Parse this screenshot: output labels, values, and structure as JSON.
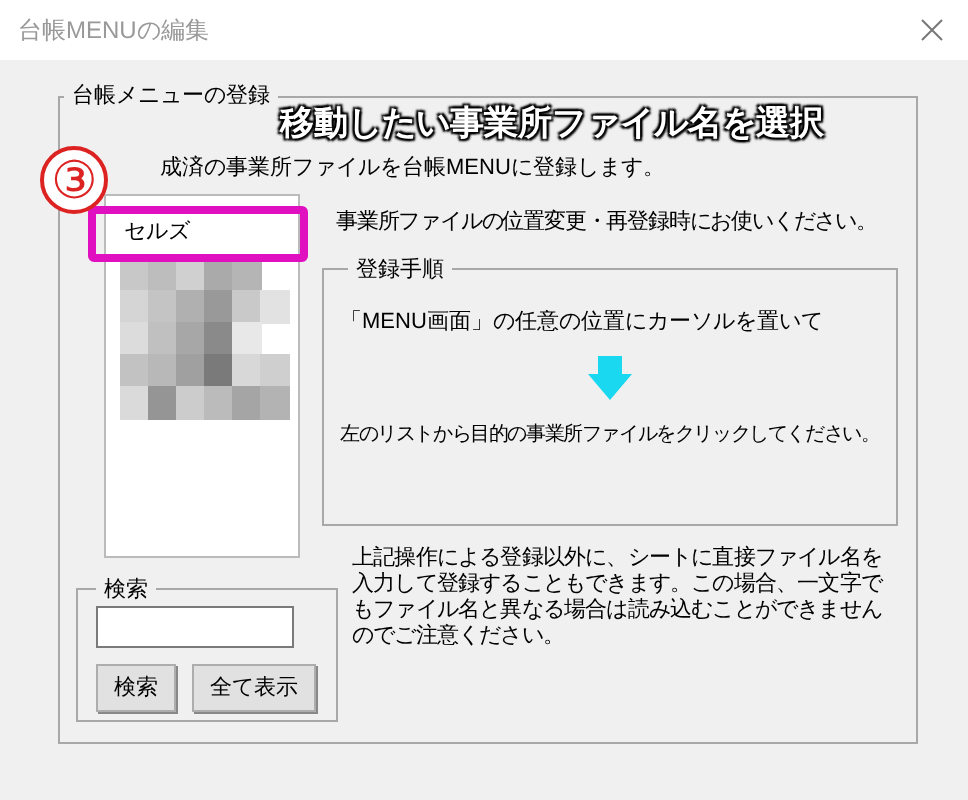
{
  "window": {
    "title": "台帳MENUの編集"
  },
  "group": {
    "title": "台帳メニューの登録",
    "intro": "成済の事業所ファイルを台帳MENUに登録します。",
    "note": "事業所ファイルの位置変更・再登録時にお使いください。"
  },
  "list": {
    "items": [
      "セルズ"
    ]
  },
  "procedure": {
    "title": "登録手順",
    "steps": [
      "「MENU画面」の任意の位置にカーソルを置いて",
      "左のリストから目的の事業所ファイルをクリックしてください。"
    ]
  },
  "search": {
    "title": "検索",
    "buttons": [
      "検索",
      "全て表示"
    ]
  },
  "footnote": "上記操作による登録以外に、シートに直接ファイル名を入力して登録することもできます。この場合、一文字でもファイル名と異なる場合は読み込むことができませんのでご注意ください。",
  "annotation": {
    "number": "③",
    "caption": "移動したい事業所ファイル名を選択"
  }
}
